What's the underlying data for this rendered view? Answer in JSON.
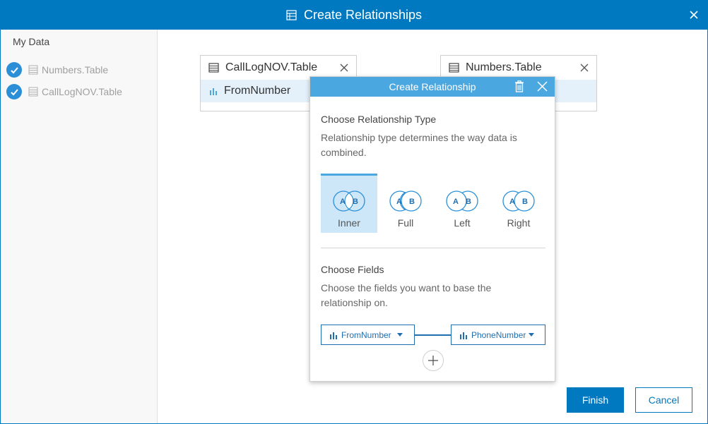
{
  "window": {
    "title": "Create Relationships",
    "icon": "relationships-table-icon",
    "close_icon": "close-icon"
  },
  "sidebar": {
    "title": "My Data",
    "datasets": [
      {
        "label": "Numbers.Table",
        "checked": true,
        "icon": "table-icon"
      },
      {
        "label": "CallLogNOV.Table",
        "checked": true,
        "icon": "table-icon"
      }
    ]
  },
  "cards": [
    {
      "title": "CallLogNOV.Table",
      "field": "FromNumber"
    },
    {
      "title": "Numbers.Table",
      "field": ""
    }
  ],
  "dialog": {
    "title": "Create Relationship",
    "type_section": {
      "title": "Choose Relationship Type",
      "description": "Relationship type determines the way data is combined.",
      "options": [
        {
          "label": "Inner",
          "selected": true
        },
        {
          "label": "Full",
          "selected": false
        },
        {
          "label": "Left",
          "selected": false
        },
        {
          "label": "Right",
          "selected": false
        }
      ],
      "venn_a": "A",
      "venn_b": "B"
    },
    "fields_section": {
      "title": "Choose Fields",
      "description": "Choose the fields you want to base the relationship on.",
      "left_field": "FromNumber",
      "right_field": "PhoneNumber"
    }
  },
  "footer": {
    "finish_label": "Finish",
    "cancel_label": "Cancel"
  },
  "colors": {
    "accent": "#0079c1",
    "dialog_header": "#4aa7e0",
    "selected_bg": "#cde7f8",
    "field_row_bg": "#e4f1fb"
  }
}
